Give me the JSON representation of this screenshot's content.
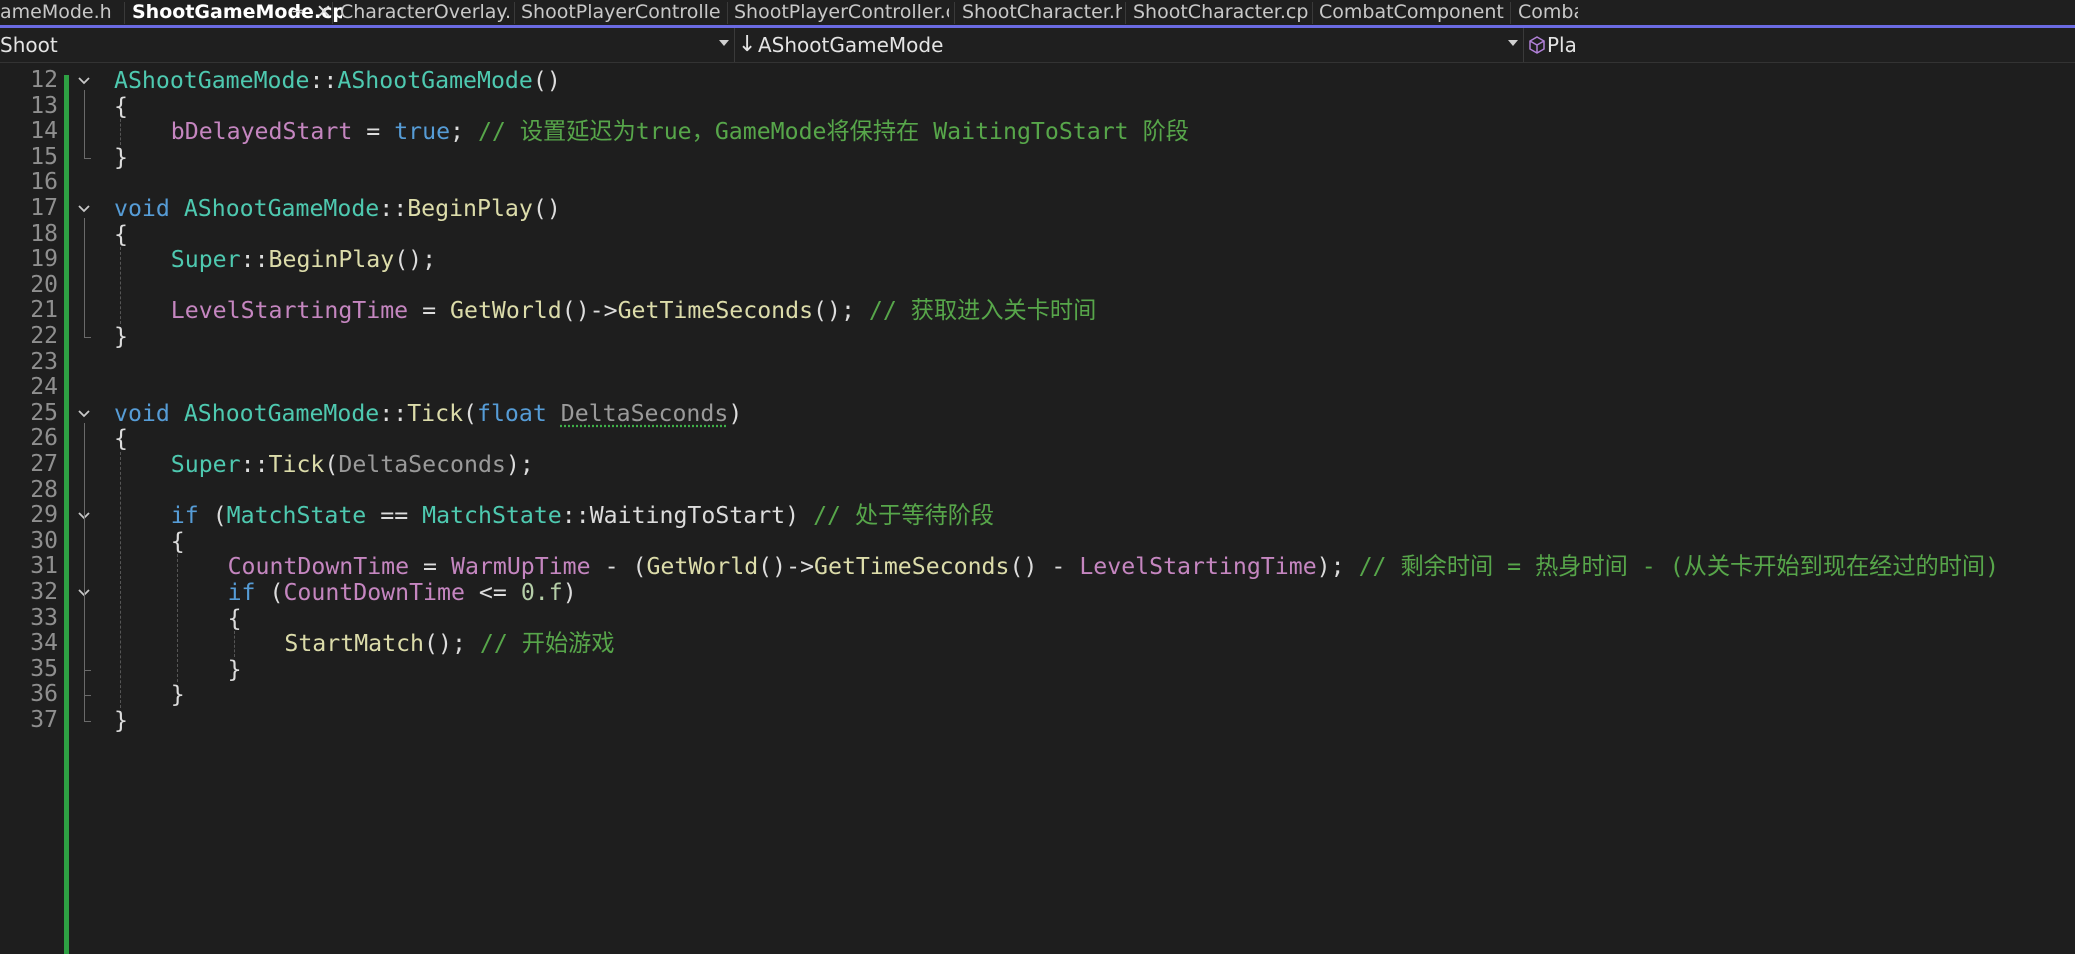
{
  "tabs": [
    {
      "label": "ameMode.h"
    },
    {
      "label": "ShootGameMode.cpp",
      "active": true
    },
    {
      "label": "CharacterOverlay.h"
    },
    {
      "label": "ShootPlayerController.h"
    },
    {
      "label": "ShootPlayerController.cpp"
    },
    {
      "label": "ShootCharacter.h"
    },
    {
      "label": "ShootCharacter.cpp"
    },
    {
      "label": "CombatComponent.h"
    },
    {
      "label": "Combat"
    }
  ],
  "tab_icons": {
    "pin": "pin-icon",
    "close": "close-icon"
  },
  "nav": {
    "project": "Shoot",
    "scope_icon": "down-arrow-icon",
    "scope": "AShootGameMode",
    "member_icon": "cube-icon",
    "member": "Play"
  },
  "code_lines": [
    {
      "n": "12",
      "fold": true,
      "text": "AShootGameMode::AShootGameMode()"
    },
    {
      "n": "13",
      "text": "{"
    },
    {
      "n": "14",
      "text": "bDelayedStart = true; // 设置延迟为true，GameMode将保持在 WaitingToStart 阶段"
    },
    {
      "n": "15",
      "text": "}"
    },
    {
      "n": "16",
      "text": ""
    },
    {
      "n": "17",
      "fold": true,
      "text": "void AShootGameMode::BeginPlay()"
    },
    {
      "n": "18",
      "text": "{"
    },
    {
      "n": "19",
      "text": "Super::BeginPlay();"
    },
    {
      "n": "20",
      "text": ""
    },
    {
      "n": "21",
      "text": "LevelStartingTime = GetWorld()->GetTimeSeconds(); // 获取进入关卡时间"
    },
    {
      "n": "22",
      "text": "}"
    },
    {
      "n": "23",
      "text": ""
    },
    {
      "n": "24",
      "text": ""
    },
    {
      "n": "25",
      "fold": true,
      "text": "void AShootGameMode::Tick(float DeltaSeconds)"
    },
    {
      "n": "26",
      "text": "{"
    },
    {
      "n": "27",
      "text": "Super::Tick(DeltaSeconds);"
    },
    {
      "n": "28",
      "text": ""
    },
    {
      "n": "29",
      "fold": true,
      "text": "if (MatchState == MatchState::WaitingToStart) // 处于等待阶段"
    },
    {
      "n": "30",
      "text": "{"
    },
    {
      "n": "31",
      "text": "CountDownTime = WarmUpTime - (GetWorld()->GetTimeSeconds() - LevelStartingTime); // 剩余时间 = 热身时间 - (从关卡开始到现在经过的时间)"
    },
    {
      "n": "32",
      "fold": true,
      "text": "if (CountDownTime <= 0.f)"
    },
    {
      "n": "33",
      "text": "{"
    },
    {
      "n": "34",
      "text": "StartMatch(); // 开始游戏"
    },
    {
      "n": "35",
      "text": "}"
    },
    {
      "n": "36",
      "text": "}"
    },
    {
      "n": "37",
      "text": "}"
    }
  ],
  "colors": {
    "background": "#1e1e1e",
    "type": "#4ec9b0",
    "keyword": "#569cd6",
    "function": "#dcdcaa",
    "member_variable": "#c586c0",
    "parameter": "#9a9a9a",
    "number": "#b5cea8",
    "comment": "#57a64a",
    "change_bar": "#2ea043",
    "active_tab_underline": "#6a6ae2"
  }
}
